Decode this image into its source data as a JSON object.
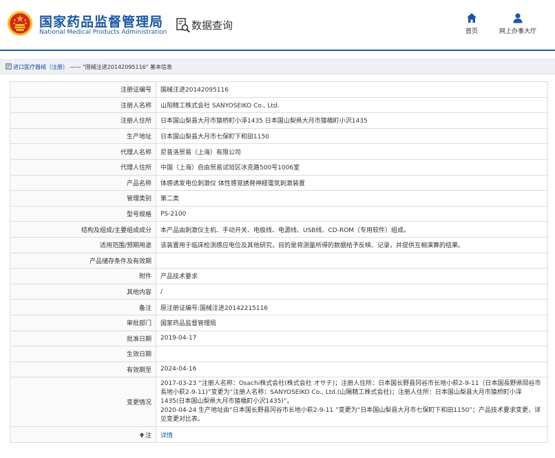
{
  "header": {
    "brand_cn": "国家药品监督管理局",
    "brand_en": "National Medical Products Administration",
    "query_label": "数据查询",
    "nav": {
      "home_label": "首页",
      "lobby_label": "网上办事大厅"
    }
  },
  "breadcrumb": {
    "category": "进口医疗器械（注册）",
    "separator": "——",
    "current": "\"国械注进20142095116\"",
    "suffix": "基本信息"
  },
  "rows": [
    {
      "label": "注册证编号",
      "value": "国械注进20142095116"
    },
    {
      "label": "注册人名称",
      "value": "山阳精工株式会社 SANYOSEIKO Co., Ltd."
    },
    {
      "label": "注册人住所",
      "value": "日本国山梨县大月市猿桥町小泽1435 日本国山梨県大月市猿橋町小沢1435"
    },
    {
      "label": "生产地址",
      "value": "日本国山梨县大月市七保町下和田1150"
    },
    {
      "label": "代理人名称",
      "value": "尼普洛贸易（上海）有限公司"
    },
    {
      "label": "代理人住所",
      "value": "中国（上海）自由贸易试验区冰克路500号1006室"
    },
    {
      "label": "产品名称",
      "value": "体感诱发电位刺激仪 体性感覚誘発神経電気刺激装置"
    },
    {
      "label": "管理类别",
      "value": "第二类"
    },
    {
      "label": "型号规格",
      "value": "PS-2100"
    },
    {
      "label": "结构及组成/主要组成成分",
      "value": "本产品由刺激仪主机、手动开关、电极线、电源线、USB线、CD-ROM（专用软件）组成。"
    },
    {
      "label": "适用范围/预期用途",
      "value": "该装置用于临床检测感应电位及其他研究，目的是将测量所得的数据给予反映、记录，并提供互相演算的结果。"
    },
    {
      "label": "产品储存条件及有效期",
      "value": ""
    },
    {
      "label": "附件",
      "value": "产品技术要求"
    },
    {
      "label": "其他内容",
      "value": "/"
    },
    {
      "label": "备注",
      "value": "原注册证编号:国械注进20142215116"
    },
    {
      "label": "审批部门",
      "value": "国家药品监督管理局"
    },
    {
      "label": "批准日期",
      "value": "2019-04-17"
    },
    {
      "label": "生效日期",
      "value": ""
    },
    {
      "label": "有效期至",
      "value": "2024-04-16"
    }
  ],
  "change_row": {
    "label": "变更情况",
    "value": "2017-03-23 “注册人名称：Osachi株式会社(株式会社 オサチ)；注册人住所：日本国长野县冈谷市长地小萩2-9-11（日本国長野県岡谷市長地小萩2-9-11)”变更为“注册人名称：SANYOSEIKO Co., Ltd.(山陽精工株式会社)；注册人住所：日本国山梨县大月市猿桥町小泽1435(日本国山梨県大月市猿橋町小沢1435)”。\n2020-04-24 生产地址由“日本国长野县冈谷市长地小萩2-9-11 ”变更为“日本国山梨县大月市七保町下和田1150”；产品技术要求变更，详见变更对比表。"
  },
  "note_row": {
    "label": "注",
    "value": "详情"
  },
  "colors": {
    "brand_blue": "#1a56a6",
    "emblem_red": "#d7261e",
    "emblem_gold": "#f3c423"
  },
  "icons": [
    "national-emblem-icon",
    "search-document-icon",
    "home-icon",
    "user-icon",
    "document-icon",
    "note-icon"
  ]
}
